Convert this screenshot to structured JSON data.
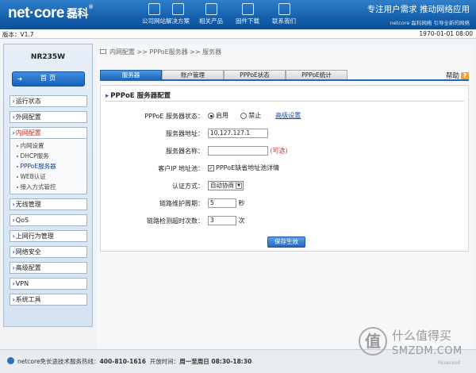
{
  "header": {
    "logo_main": "net·core",
    "logo_cn": "磊科",
    "logo_reg": "®",
    "nav": [
      {
        "label": "公司网站",
        "icon": "monitor-icon"
      },
      {
        "label": "解决方案",
        "icon": "tools-icon"
      },
      {
        "label": "相关产品",
        "icon": "router-icon"
      },
      {
        "label": "固件下载",
        "icon": "download-icon"
      },
      {
        "label": "联系我们",
        "icon": "mail-icon"
      }
    ],
    "slogan_main": "专注用户需求    推动网络应用",
    "slogan_sub": "netcore 磊科网络  引导全新的网络"
  },
  "version_bar": {
    "version": "版本：V1.7",
    "datetime": "1970-01-01 08:00"
  },
  "sidebar": {
    "model": "NR235W",
    "home": "首    页",
    "items": [
      {
        "label": "运行状态"
      },
      {
        "label": "外网配置"
      },
      {
        "label": "内网配置",
        "open": true,
        "sub": [
          "内网设置",
          "DHCP服务",
          "PPPoE服务器",
          "WEB认证",
          "接入方式管控"
        ]
      },
      {
        "label": "无线管理"
      },
      {
        "label": "QoS"
      },
      {
        "label": "上网行为管理"
      },
      {
        "label": "网络安全"
      },
      {
        "label": "高级配置"
      },
      {
        "label": "VPN"
      },
      {
        "label": "系统工具"
      }
    ]
  },
  "main": {
    "breadcrumb": "内网配置  >>  PPPoE服务器  >>  服务器",
    "tabs": [
      "服务器",
      "账户管理",
      "PPPoE状态",
      "PPPoE统计"
    ],
    "help": "帮助",
    "panel_title": "PPPoE 服务器配置",
    "form": {
      "status_label": "PPPoE 服务器状态：",
      "enable": "启用",
      "disable": "禁止",
      "advanced": "高级设置",
      "address_label": "服务器地址：",
      "address_value": "10.127.127.1",
      "name_label": "服务器名称：",
      "name_value": "",
      "required": "(可选)",
      "pool_label": "客户IP 地址池：",
      "pool_check": "PPPoE缺省地址池",
      "pool_detail": "详情",
      "auth_label": "认证方式：",
      "auth_value": "自动协商",
      "keepalive_label": "链路维护周期：",
      "keepalive_value": "5",
      "keepalive_unit": "秒",
      "retry_label": "链路检测超时次数：",
      "retry_value": "3",
      "retry_unit": "次",
      "save": "保存生效"
    }
  },
  "footer": {
    "hotline_label": "netcore免长途技术服务热线：",
    "hotline": "400-810-1616",
    "hours_label": "开放时间：",
    "hours": "周一至周日 08:30-18:30"
  },
  "watermark": {
    "glyph": "值",
    "cn": "什么值得买",
    "en": "SMZDM.COM",
    "reserved": "Reserved"
  }
}
